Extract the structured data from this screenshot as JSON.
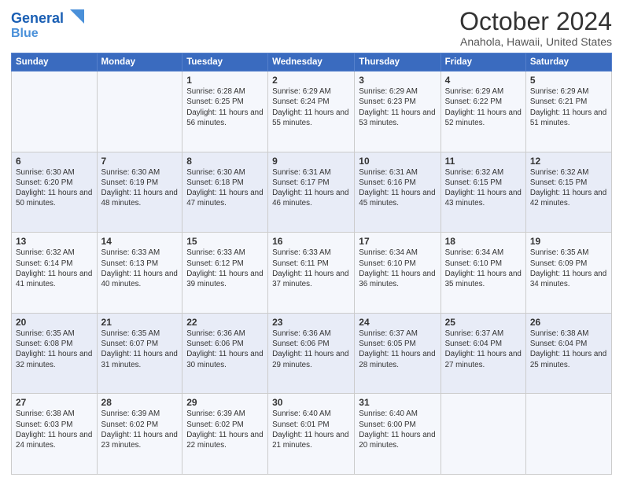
{
  "logo": {
    "line1": "General",
    "line2": "Blue"
  },
  "title": "October 2024",
  "location": "Anahola, Hawaii, United States",
  "days_of_week": [
    "Sunday",
    "Monday",
    "Tuesday",
    "Wednesday",
    "Thursday",
    "Friday",
    "Saturday"
  ],
  "weeks": [
    [
      {
        "num": "",
        "sunrise": "",
        "sunset": "",
        "daylight": ""
      },
      {
        "num": "",
        "sunrise": "",
        "sunset": "",
        "daylight": ""
      },
      {
        "num": "1",
        "sunrise": "Sunrise: 6:28 AM",
        "sunset": "Sunset: 6:25 PM",
        "daylight": "Daylight: 11 hours and 56 minutes."
      },
      {
        "num": "2",
        "sunrise": "Sunrise: 6:29 AM",
        "sunset": "Sunset: 6:24 PM",
        "daylight": "Daylight: 11 hours and 55 minutes."
      },
      {
        "num": "3",
        "sunrise": "Sunrise: 6:29 AM",
        "sunset": "Sunset: 6:23 PM",
        "daylight": "Daylight: 11 hours and 53 minutes."
      },
      {
        "num": "4",
        "sunrise": "Sunrise: 6:29 AM",
        "sunset": "Sunset: 6:22 PM",
        "daylight": "Daylight: 11 hours and 52 minutes."
      },
      {
        "num": "5",
        "sunrise": "Sunrise: 6:29 AM",
        "sunset": "Sunset: 6:21 PM",
        "daylight": "Daylight: 11 hours and 51 minutes."
      }
    ],
    [
      {
        "num": "6",
        "sunrise": "Sunrise: 6:30 AM",
        "sunset": "Sunset: 6:20 PM",
        "daylight": "Daylight: 11 hours and 50 minutes."
      },
      {
        "num": "7",
        "sunrise": "Sunrise: 6:30 AM",
        "sunset": "Sunset: 6:19 PM",
        "daylight": "Daylight: 11 hours and 48 minutes."
      },
      {
        "num": "8",
        "sunrise": "Sunrise: 6:30 AM",
        "sunset": "Sunset: 6:18 PM",
        "daylight": "Daylight: 11 hours and 47 minutes."
      },
      {
        "num": "9",
        "sunrise": "Sunrise: 6:31 AM",
        "sunset": "Sunset: 6:17 PM",
        "daylight": "Daylight: 11 hours and 46 minutes."
      },
      {
        "num": "10",
        "sunrise": "Sunrise: 6:31 AM",
        "sunset": "Sunset: 6:16 PM",
        "daylight": "Daylight: 11 hours and 45 minutes."
      },
      {
        "num": "11",
        "sunrise": "Sunrise: 6:32 AM",
        "sunset": "Sunset: 6:15 PM",
        "daylight": "Daylight: 11 hours and 43 minutes."
      },
      {
        "num": "12",
        "sunrise": "Sunrise: 6:32 AM",
        "sunset": "Sunset: 6:15 PM",
        "daylight": "Daylight: 11 hours and 42 minutes."
      }
    ],
    [
      {
        "num": "13",
        "sunrise": "Sunrise: 6:32 AM",
        "sunset": "Sunset: 6:14 PM",
        "daylight": "Daylight: 11 hours and 41 minutes."
      },
      {
        "num": "14",
        "sunrise": "Sunrise: 6:33 AM",
        "sunset": "Sunset: 6:13 PM",
        "daylight": "Daylight: 11 hours and 40 minutes."
      },
      {
        "num": "15",
        "sunrise": "Sunrise: 6:33 AM",
        "sunset": "Sunset: 6:12 PM",
        "daylight": "Daylight: 11 hours and 39 minutes."
      },
      {
        "num": "16",
        "sunrise": "Sunrise: 6:33 AM",
        "sunset": "Sunset: 6:11 PM",
        "daylight": "Daylight: 11 hours and 37 minutes."
      },
      {
        "num": "17",
        "sunrise": "Sunrise: 6:34 AM",
        "sunset": "Sunset: 6:10 PM",
        "daylight": "Daylight: 11 hours and 36 minutes."
      },
      {
        "num": "18",
        "sunrise": "Sunrise: 6:34 AM",
        "sunset": "Sunset: 6:10 PM",
        "daylight": "Daylight: 11 hours and 35 minutes."
      },
      {
        "num": "19",
        "sunrise": "Sunrise: 6:35 AM",
        "sunset": "Sunset: 6:09 PM",
        "daylight": "Daylight: 11 hours and 34 minutes."
      }
    ],
    [
      {
        "num": "20",
        "sunrise": "Sunrise: 6:35 AM",
        "sunset": "Sunset: 6:08 PM",
        "daylight": "Daylight: 11 hours and 32 minutes."
      },
      {
        "num": "21",
        "sunrise": "Sunrise: 6:35 AM",
        "sunset": "Sunset: 6:07 PM",
        "daylight": "Daylight: 11 hours and 31 minutes."
      },
      {
        "num": "22",
        "sunrise": "Sunrise: 6:36 AM",
        "sunset": "Sunset: 6:06 PM",
        "daylight": "Daylight: 11 hours and 30 minutes."
      },
      {
        "num": "23",
        "sunrise": "Sunrise: 6:36 AM",
        "sunset": "Sunset: 6:06 PM",
        "daylight": "Daylight: 11 hours and 29 minutes."
      },
      {
        "num": "24",
        "sunrise": "Sunrise: 6:37 AM",
        "sunset": "Sunset: 6:05 PM",
        "daylight": "Daylight: 11 hours and 28 minutes."
      },
      {
        "num": "25",
        "sunrise": "Sunrise: 6:37 AM",
        "sunset": "Sunset: 6:04 PM",
        "daylight": "Daylight: 11 hours and 27 minutes."
      },
      {
        "num": "26",
        "sunrise": "Sunrise: 6:38 AM",
        "sunset": "Sunset: 6:04 PM",
        "daylight": "Daylight: 11 hours and 25 minutes."
      }
    ],
    [
      {
        "num": "27",
        "sunrise": "Sunrise: 6:38 AM",
        "sunset": "Sunset: 6:03 PM",
        "daylight": "Daylight: 11 hours and 24 minutes."
      },
      {
        "num": "28",
        "sunrise": "Sunrise: 6:39 AM",
        "sunset": "Sunset: 6:02 PM",
        "daylight": "Daylight: 11 hours and 23 minutes."
      },
      {
        "num": "29",
        "sunrise": "Sunrise: 6:39 AM",
        "sunset": "Sunset: 6:02 PM",
        "daylight": "Daylight: 11 hours and 22 minutes."
      },
      {
        "num": "30",
        "sunrise": "Sunrise: 6:40 AM",
        "sunset": "Sunset: 6:01 PM",
        "daylight": "Daylight: 11 hours and 21 minutes."
      },
      {
        "num": "31",
        "sunrise": "Sunrise: 6:40 AM",
        "sunset": "Sunset: 6:00 PM",
        "daylight": "Daylight: 11 hours and 20 minutes."
      },
      {
        "num": "",
        "sunrise": "",
        "sunset": "",
        "daylight": ""
      },
      {
        "num": "",
        "sunrise": "",
        "sunset": "",
        "daylight": ""
      }
    ]
  ]
}
